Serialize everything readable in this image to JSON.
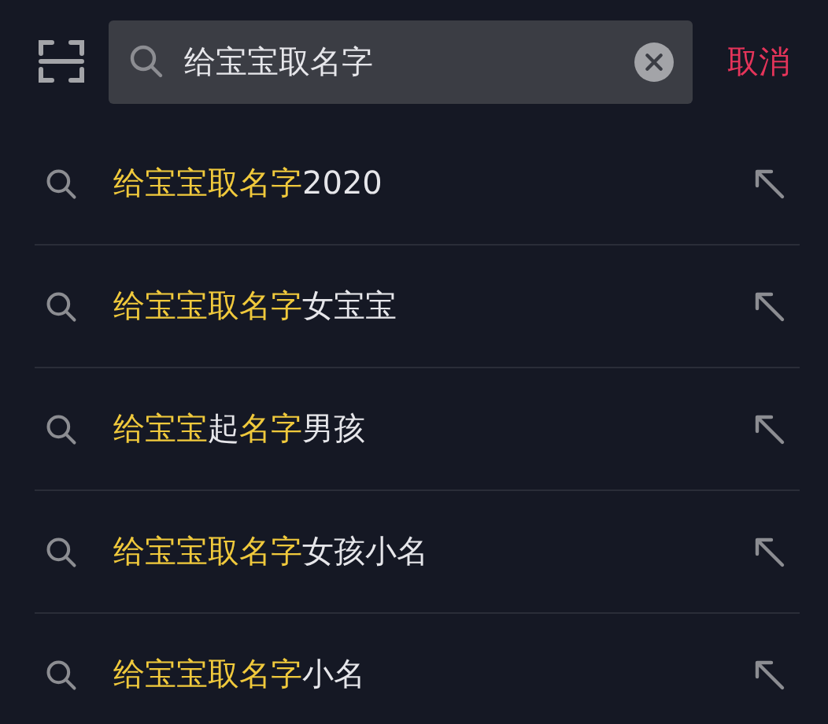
{
  "search": {
    "value": "给宝宝取名字"
  },
  "cancel": "取消",
  "suggestions": [
    {
      "parts": [
        {
          "text": "给宝宝取名字",
          "highlighted": true
        },
        {
          "text": "2020",
          "highlighted": false
        }
      ]
    },
    {
      "parts": [
        {
          "text": "给宝宝取名字",
          "highlighted": true
        },
        {
          "text": "女宝宝",
          "highlighted": false
        }
      ]
    },
    {
      "parts": [
        {
          "text": "给宝宝",
          "highlighted": true
        },
        {
          "text": "起",
          "highlighted": false
        },
        {
          "text": "名字",
          "highlighted": true
        },
        {
          "text": "男孩",
          "highlighted": false
        }
      ]
    },
    {
      "parts": [
        {
          "text": "给宝宝取名字",
          "highlighted": true
        },
        {
          "text": "女孩小名",
          "highlighted": false
        }
      ]
    },
    {
      "parts": [
        {
          "text": "给宝宝取名字",
          "highlighted": true
        },
        {
          "text": "小名",
          "highlighted": false
        }
      ]
    }
  ]
}
